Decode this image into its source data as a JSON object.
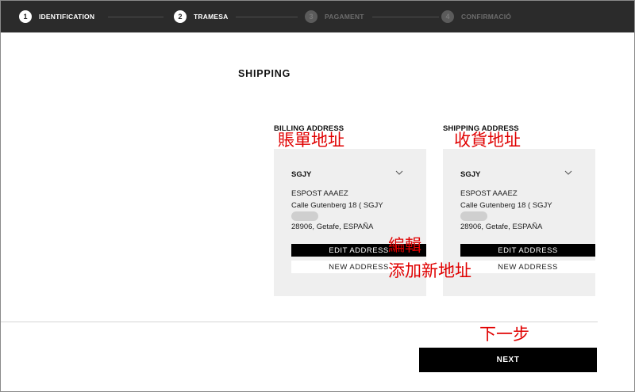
{
  "stepper": {
    "steps": [
      {
        "number": "1",
        "label": "IDENTIFICATION"
      },
      {
        "number": "2",
        "label": "TRAMESA"
      },
      {
        "number": "3",
        "label": "PAGAMENT"
      },
      {
        "number": "4",
        "label": "CONFIRMACIÓ"
      }
    ]
  },
  "page_title": "SHIPPING",
  "billing": {
    "header": "BILLING ADDRESS",
    "annotation": "賬單地址",
    "selected": "SGJY",
    "lines": [
      "ESPOST AAAEZ",
      "Calle Gutenberg 18 ( SGJY",
      "28906, Getafe, ESPAÑA"
    ],
    "edit_label": "EDIT ADDRESS",
    "new_label": "NEW ADDRESS"
  },
  "shipping": {
    "header": "SHIPPING ADDRESS",
    "annotation": "收貨地址",
    "selected": "SGJY",
    "lines": [
      "ESPOST AAAEZ",
      "Calle Gutenberg 18 ( SGJY",
      "28906, Getafe, ESPAÑA"
    ],
    "edit_label": "EDIT ADDRESS",
    "new_label": "NEW ADDRESS"
  },
  "annotations": {
    "edit": "編輯",
    "add_new": "添加新地址",
    "next_step": "下一步"
  },
  "next_label": "NEXT"
}
